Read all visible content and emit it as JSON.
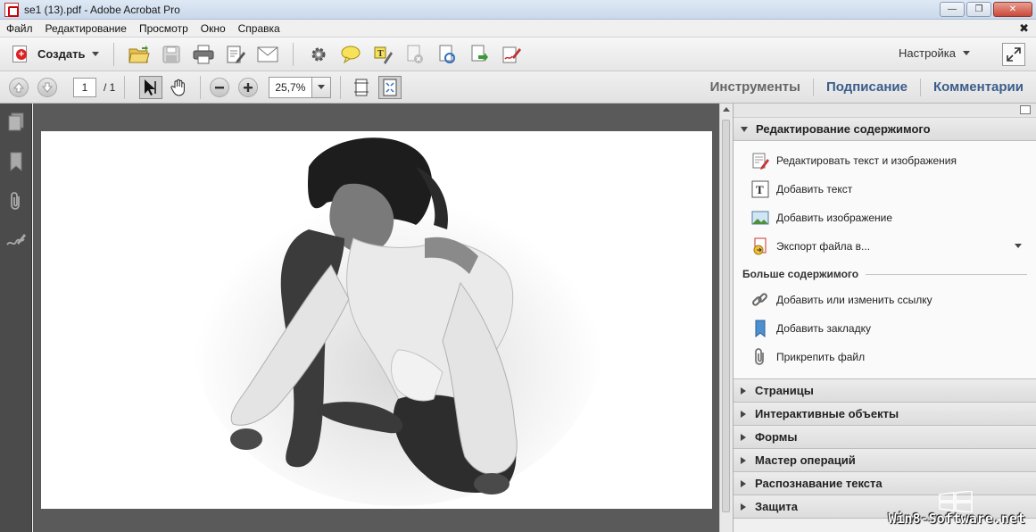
{
  "window": {
    "title": "se1 (13).pdf - Adobe Acrobat Pro"
  },
  "menu": [
    "Файл",
    "Редактирование",
    "Просмотр",
    "Окно",
    "Справка"
  ],
  "toolbar": {
    "create_label": "Создать",
    "settings_label": "Настройка",
    "icons": [
      "open-folder-icon",
      "save-icon",
      "print-icon",
      "edit-document-icon",
      "email-icon",
      "gear-icon",
      "comment-icon",
      "highlight-text-icon",
      "delete-page-icon",
      "rotate-page-icon",
      "export-icon",
      "sign-icon"
    ]
  },
  "nav": {
    "page_current": "1",
    "page_total": "/ 1",
    "zoom": "25,7%"
  },
  "pane_tabs": [
    "Инструменты",
    "Подписание",
    "Комментарии"
  ],
  "right_panel": {
    "section_open": "Редактирование содержимого",
    "tools": [
      {
        "label": "Редактировать текст и изображения",
        "icon": "edit-text-image-icon"
      },
      {
        "label": "Добавить текст",
        "icon": "add-text-icon"
      },
      {
        "label": "Добавить изображение",
        "icon": "add-image-icon"
      },
      {
        "label": "Экспорт файла в...",
        "icon": "export-file-icon"
      }
    ],
    "more_heading": "Больше содержимого",
    "more_tools": [
      {
        "label": "Добавить или изменить ссылку",
        "icon": "link-icon"
      },
      {
        "label": "Добавить закладку",
        "icon": "bookmark-icon"
      },
      {
        "label": "Прикрепить файл",
        "icon": "paperclip-icon"
      }
    ],
    "collapsed_sections": [
      "Страницы",
      "Интерактивные объекты",
      "Формы",
      "Мастер операций",
      "Распознавание текста",
      "Защита"
    ]
  },
  "watermark": "Win8-Software.net"
}
